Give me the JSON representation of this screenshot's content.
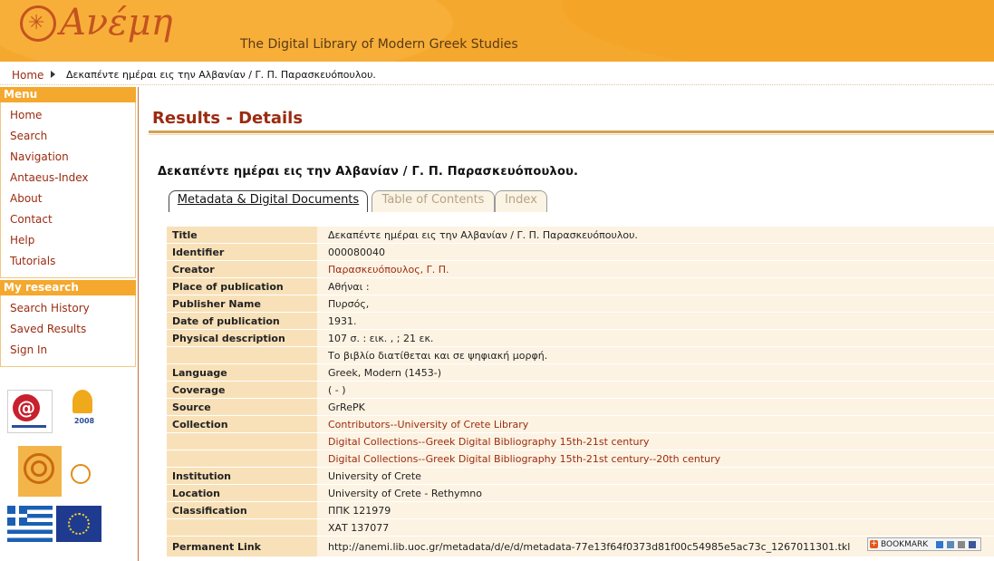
{
  "header": {
    "logo_text": "Ανέμη",
    "subtitle": "The Digital Library of Modern Greek Studies"
  },
  "breadcrumb": {
    "home": "Home",
    "current": "Δεκαπέντε ημέραι εις την Αλβανίαν / Γ. Π. Παρασκευόπουλου."
  },
  "sidebar": {
    "menu_heading": "Menu",
    "menu_items": [
      "Home",
      "Search",
      "Navigation",
      "Antaeus-Index",
      "About",
      "Contact",
      "Help",
      "Tutorials"
    ],
    "research_heading": "My research",
    "research_items": [
      "Search History",
      "Saved Results",
      "Sign In"
    ]
  },
  "main": {
    "page_title": "Results - Details",
    "record_title": "Δεκαπέντε ημέραι εις την Αλβανίαν / Γ. Π. Παρασκευόπουλου.",
    "tabs": [
      {
        "label": "Metadata & Digital Documents",
        "active": true
      },
      {
        "label": "Table of Contents",
        "active": false
      },
      {
        "label": "Index",
        "active": false
      }
    ],
    "rows": [
      {
        "label": "Title",
        "value": "Δεκαπέντε ημέραι εις την Αλβανίαν / Γ. Π. Παρασκευόπουλου.",
        "link": false
      },
      {
        "label": "Identifier",
        "value": "000080040",
        "link": false
      },
      {
        "label": "Creator",
        "value": "Παρασκευόπουλος, Γ. Π.",
        "link": true
      },
      {
        "label": "Place of publication",
        "value": "Αθήναι :",
        "link": false
      },
      {
        "label": "Publisher Name",
        "value": "Πυρσός,",
        "link": false
      },
      {
        "label": "Date of publication",
        "value": "1931.",
        "link": false
      },
      {
        "label": "Physical description",
        "value": "107 σ. : εικ. , ; 21 εκ.",
        "link": false
      },
      {
        "label": "",
        "value": "Το βιβλίο διατίθεται και σε ψηφιακή μορφή.",
        "link": false
      },
      {
        "label": "Language",
        "value": "Greek, Modern (1453-)",
        "link": false
      },
      {
        "label": "Coverage",
        "value": "( - )",
        "link": false
      },
      {
        "label": "Source",
        "value": "GrRePK",
        "link": false
      },
      {
        "label": "Collection",
        "value": "Contributors--University of Crete Library",
        "link": true
      },
      {
        "label": "",
        "value": "Digital Collections--Greek Digital Bibliography 15th-21st century",
        "link": true
      },
      {
        "label": "",
        "value": "Digital Collections--Greek Digital Bibliography 15th-21st century--20th century",
        "link": true
      },
      {
        "label": "Institution",
        "value": "University of Crete",
        "link": false
      },
      {
        "label": "Location",
        "value": "University of Crete - Rethymno",
        "link": false
      },
      {
        "label": "Classification",
        "value": "ΠΠΚ 121979",
        "link": false
      },
      {
        "label": "",
        "value": "ΧΑΤ 137077",
        "link": false
      },
      {
        "label": "Permanent Link",
        "value": "http://anemi.lib.uoc.gr/metadata/d/e/d/metadata-77e13f64f0373d81f00c54985e5ac73c_1267011301.tkl",
        "link": false
      }
    ]
  },
  "bookmark": {
    "label": "BOOKMARK",
    "icons": [
      "add-icon",
      "delicious-icon",
      "digg-icon",
      "facebook-icon"
    ]
  },
  "colors": {
    "header_orange": "#f5a82e",
    "link_red": "#9b2b11",
    "label_bg": "#f8e1b8",
    "value_bg": "#fdf3e3"
  }
}
